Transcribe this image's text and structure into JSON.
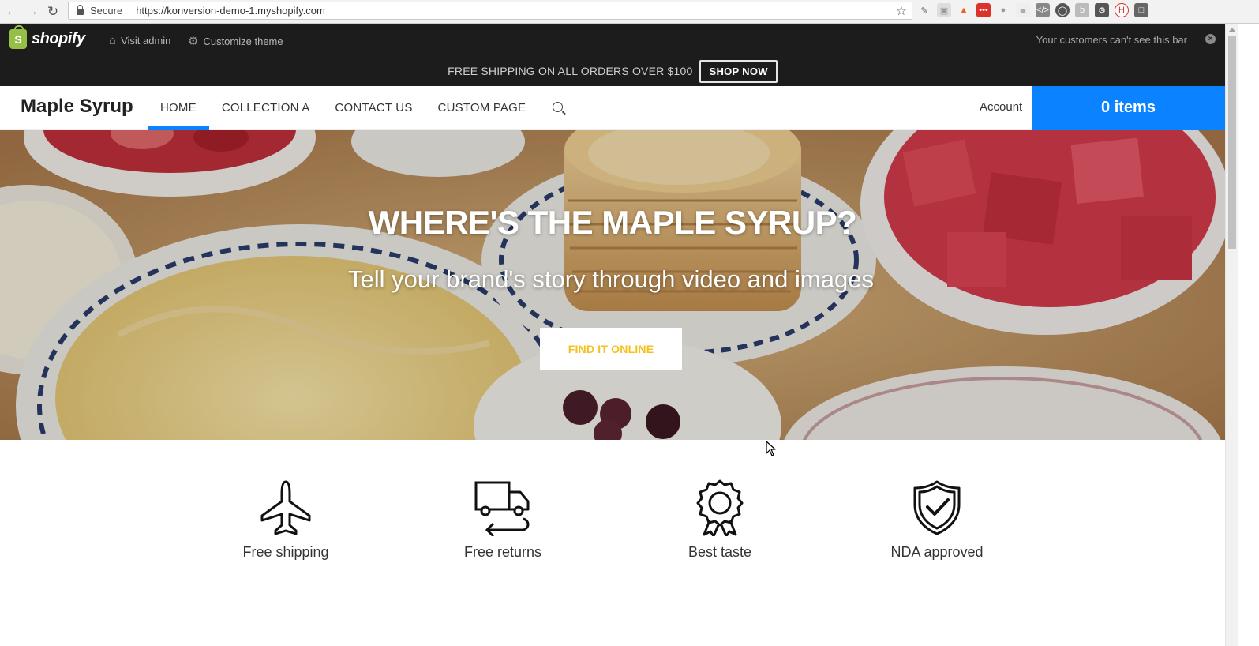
{
  "browser": {
    "secure_label": "Secure",
    "url": "https://konversion-demo-1.myshopify.com",
    "back_icon": "arrow-left-icon",
    "forward_icon": "arrow-right-icon",
    "reload_icon": "reload-icon",
    "bookmark_icon": "star-icon"
  },
  "admin_bar": {
    "logo_text": "shopify",
    "visit_admin": "Visit admin",
    "customize_theme": "Customize theme",
    "note": "Your customers can't see this bar"
  },
  "announcement": {
    "text": "FREE SHIPPING ON ALL ORDERS OVER $100",
    "button": "SHOP NOW"
  },
  "header": {
    "brand": "Maple Syrup",
    "nav": [
      {
        "label": "HOME",
        "active": true
      },
      {
        "label": "COLLECTION A",
        "active": false
      },
      {
        "label": "CONTACT US",
        "active": false
      },
      {
        "label": "CUSTOM PAGE",
        "active": false
      }
    ],
    "account": "Account",
    "cart": "0 items",
    "accent_color": "#0b82ff"
  },
  "hero": {
    "title": "WHERE'S THE MAPLE SYRUP?",
    "subtitle": "Tell your brand's story through video and images",
    "button": "FIND IT ONLINE",
    "button_text_color": "#f3c11e"
  },
  "features": [
    {
      "label": "Free shipping",
      "icon": "airplane-icon"
    },
    {
      "label": "Free returns",
      "icon": "truck-return-icon"
    },
    {
      "label": "Best taste",
      "icon": "award-ribbon-icon"
    },
    {
      "label": "NDA approved",
      "icon": "shield-check-icon"
    }
  ]
}
